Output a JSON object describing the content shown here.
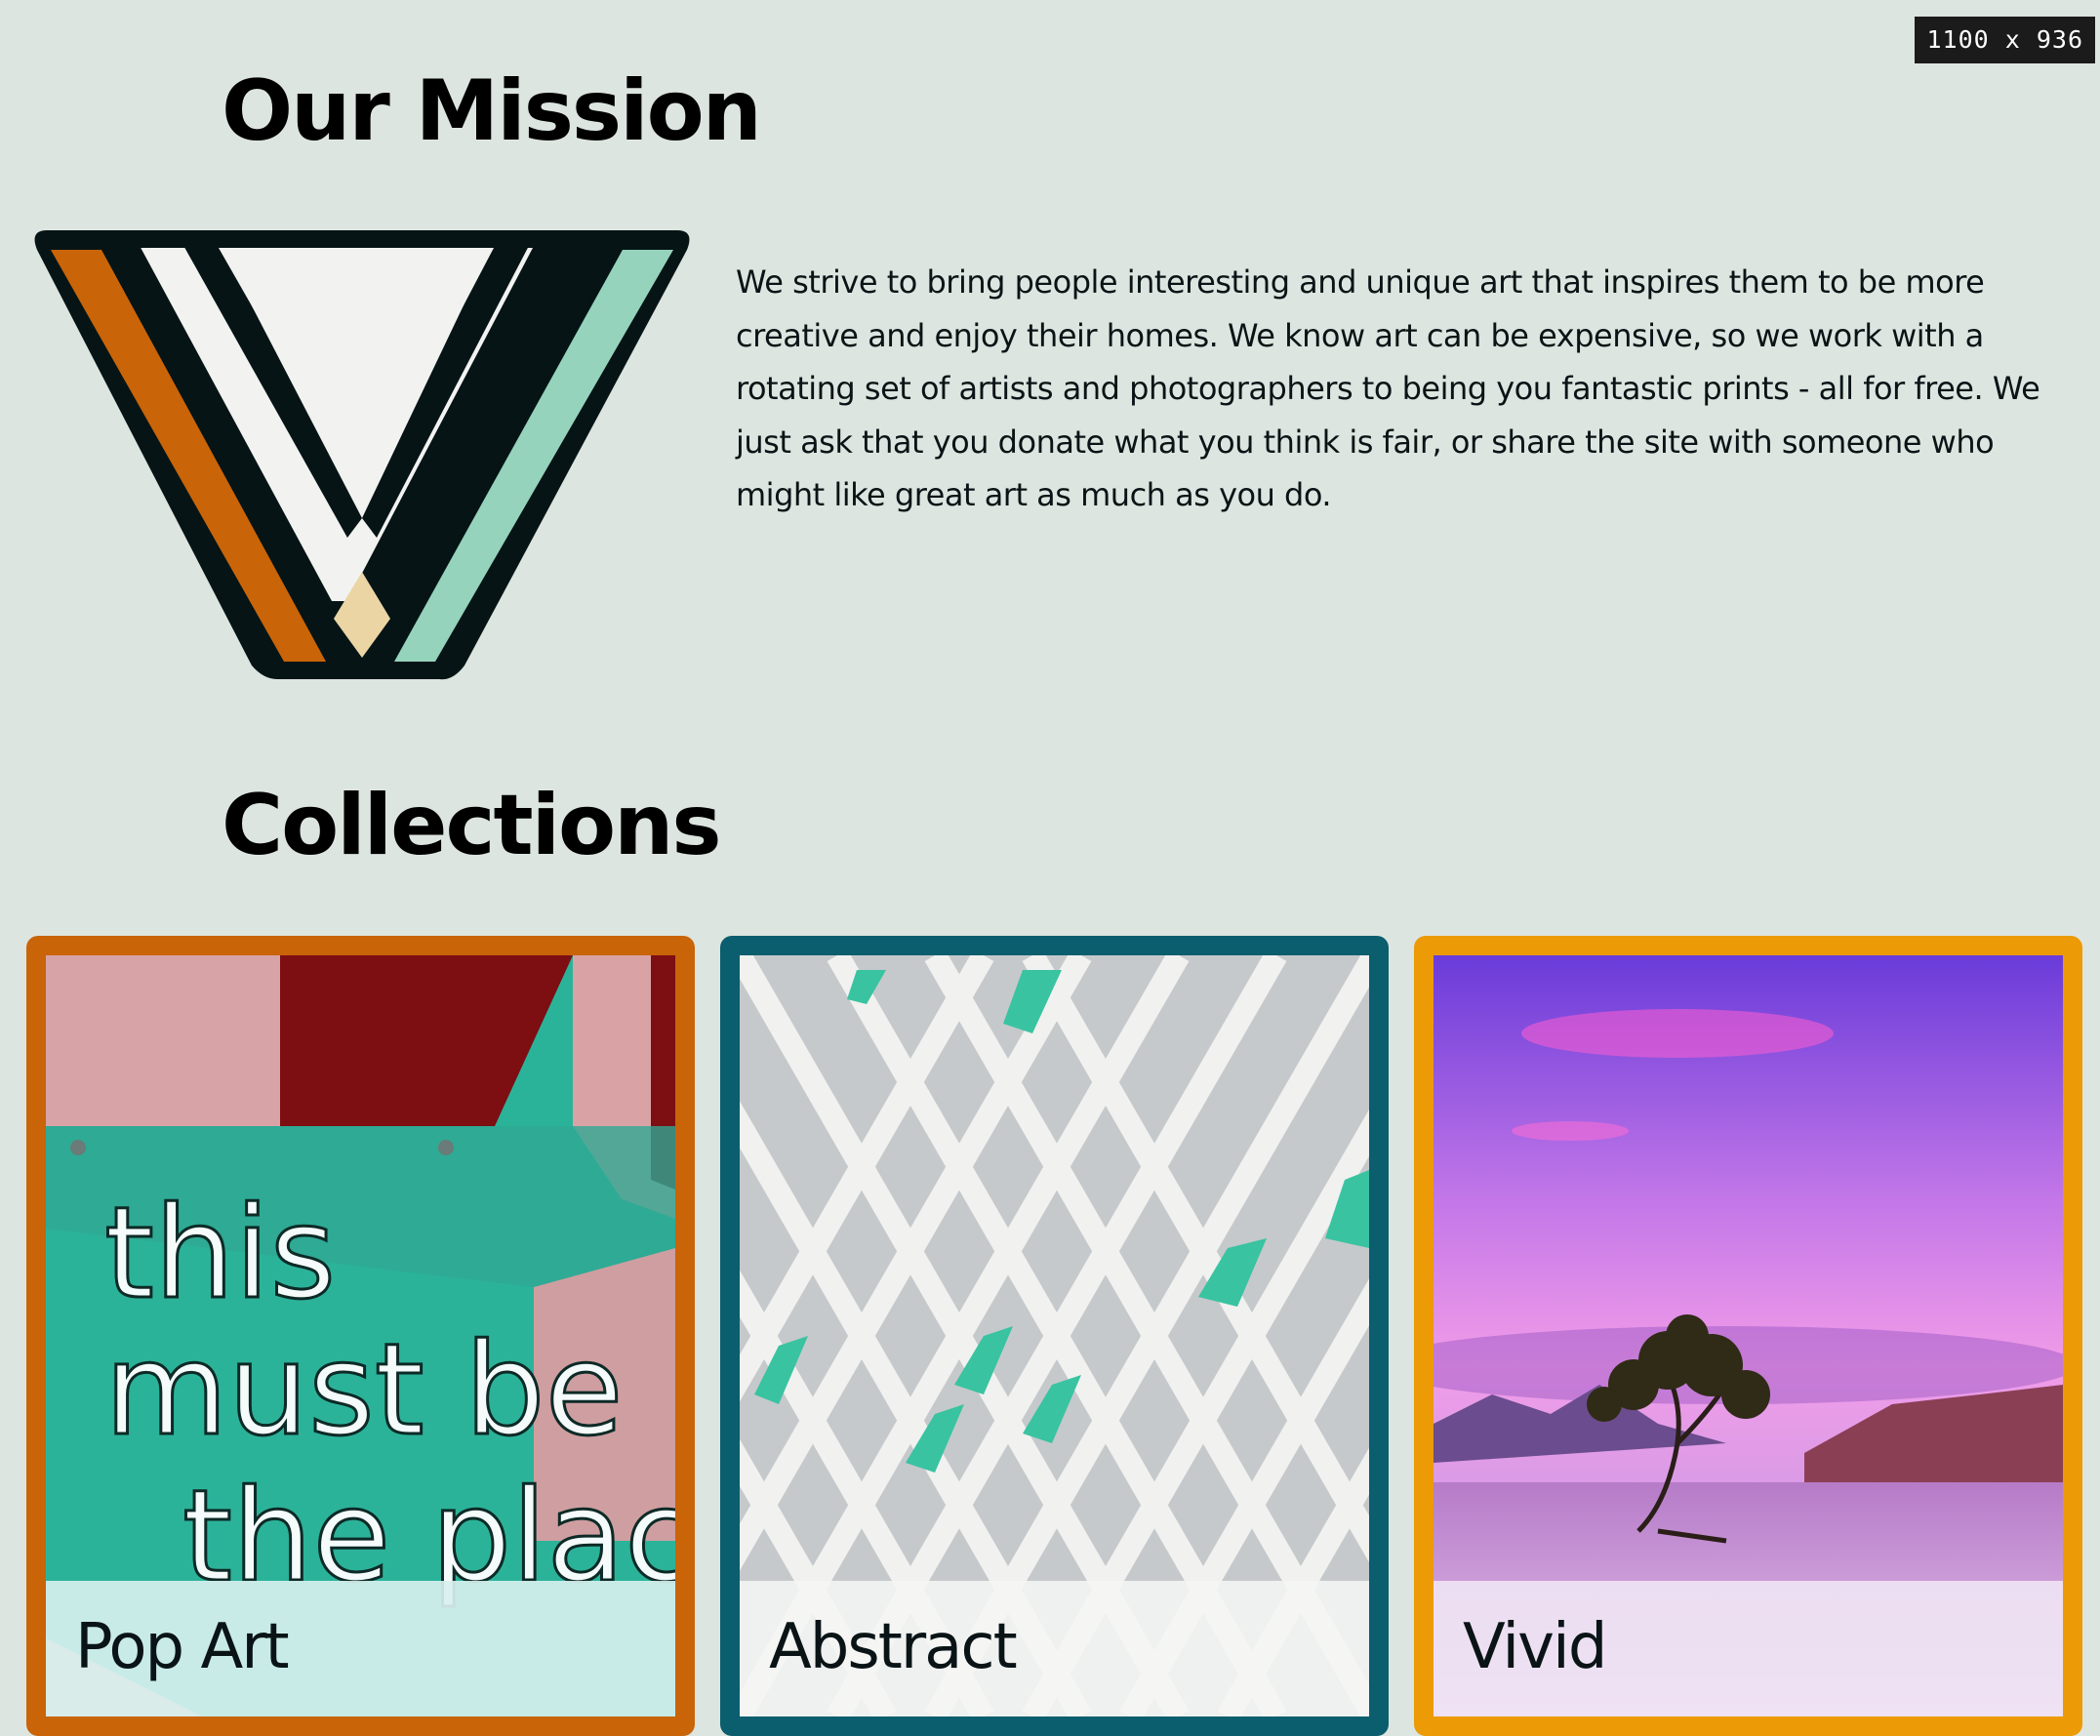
{
  "viewport_badge": "1100 x 936",
  "mission": {
    "title": "Our Mission",
    "logo_icon": "triangle-stripes-logo",
    "text": "We strive to bring people interesting and unique art that inspires them to be more creative and enjoy their homes. We know art can be expensive, so we work with a rotating set of artists and photographers to being you fantastic prints - all for free. We just ask that you donate what you think is fair, or share the site with someone who might like great art as much as you do."
  },
  "collections": {
    "title": "Collections",
    "items": [
      {
        "label": "Pop Art",
        "border_color": "#c96408",
        "neon_words": [
          "this",
          "must be",
          "the plac"
        ]
      },
      {
        "label": "Abstract",
        "border_color": "#0b5e6e"
      },
      {
        "label": "Vivid",
        "border_color": "#ec9a06"
      }
    ]
  },
  "colors": {
    "background": "#dde5e0",
    "logo_orange": "#c96408",
    "logo_mint": "#96d3bc",
    "logo_cream": "#ecd5a4",
    "logo_outline": "#061416"
  }
}
